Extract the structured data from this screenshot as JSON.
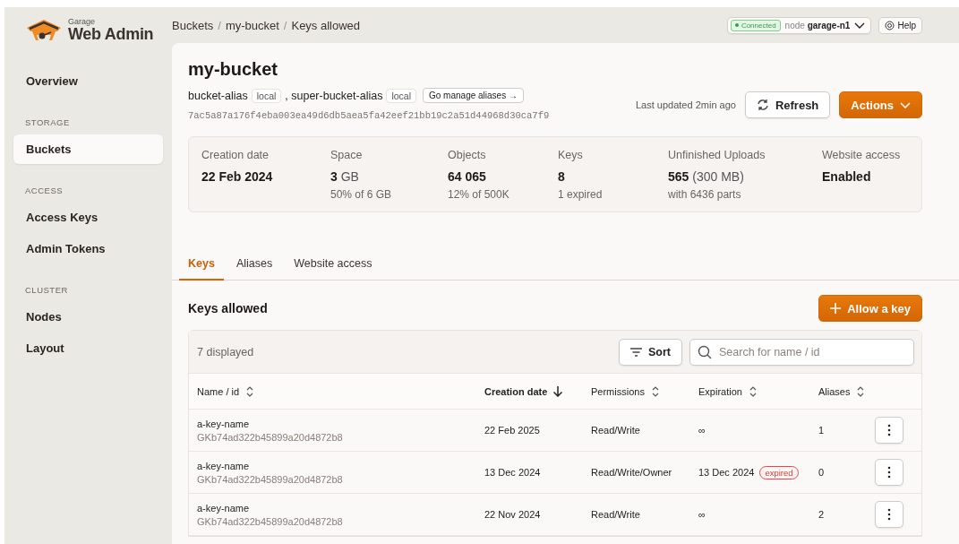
{
  "brand": {
    "small": "Garage",
    "name": "Web Admin"
  },
  "breadcrumb": [
    {
      "kind": "link",
      "label": "Buckets"
    },
    {
      "kind": "separator",
      "label": "/"
    },
    {
      "kind": "link",
      "label": "my-bucket"
    },
    {
      "kind": "separator",
      "label": "/"
    },
    {
      "kind": "current",
      "label": "Keys allowed"
    }
  ],
  "connection": {
    "status": "Connected",
    "connected": true,
    "node_label": "node",
    "node": "garage-n1"
  },
  "help_button": "Help",
  "sidebar": {
    "items": [
      {
        "kind": "item",
        "label": "Overview",
        "selected": false
      },
      {
        "kind": "section",
        "label": "STORAGE"
      },
      {
        "kind": "item",
        "label": "Buckets",
        "selected": true
      },
      {
        "kind": "section",
        "label": "ACCESS"
      },
      {
        "kind": "item",
        "label": "Access Keys",
        "selected": false
      },
      {
        "kind": "item",
        "label": "Admin Tokens",
        "selected": false
      },
      {
        "kind": "section",
        "label": "CLUSTER"
      },
      {
        "kind": "item",
        "label": "Nodes",
        "selected": false
      },
      {
        "kind": "item",
        "label": "Layout",
        "selected": false
      }
    ]
  },
  "bucket": {
    "title": "my-bucket",
    "aliases": [
      {
        "name": "bucket-alias",
        "tag": "local"
      },
      {
        "name": ", super-bucket-alias",
        "tag": "local"
      }
    ],
    "manage_aliases_button": "Go manage aliases →",
    "id": "7ac5a87a176f4eba003ea49d6db5aea5fa42eef21bb19c2a51d44968d30ca7f9",
    "last_updated": "Last updated 2min ago",
    "refresh_button": "Refresh",
    "actions_button": "Actions"
  },
  "stats": [
    {
      "label": "Creation date",
      "value": "22 Feb 2024"
    },
    {
      "label": "Space",
      "value": "3",
      "value_suffix": "GB",
      "detail": "50% of 6 GB"
    },
    {
      "label": "Objects",
      "value": "64 065",
      "detail": "12% of 500K"
    },
    {
      "label": "Keys",
      "value": "8",
      "detail": "1 expired"
    },
    {
      "label": "Unfinished Uploads",
      "value": "565",
      "value_suffix": "(300 MB)",
      "detail": "with 6436 parts"
    },
    {
      "label": "Website access",
      "value": "Enabled"
    }
  ],
  "tabs": [
    {
      "label": "Keys",
      "selected": true
    },
    {
      "label": "Aliases",
      "selected": false
    },
    {
      "label": "Website access",
      "selected": false
    }
  ],
  "keys_section": {
    "title": "Keys allowed",
    "add_button": "Allow a key",
    "count": "7 displayed",
    "sort_button": "Sort",
    "search": {
      "placeholder": "Search for name / id"
    }
  },
  "table": {
    "columns": [
      {
        "label": "Name / id",
        "sorted": false
      },
      {
        "label": "Creation date",
        "sorted": true
      },
      {
        "label": "Permissions",
        "sorted": false
      },
      {
        "label": "Expiration",
        "sorted": false
      },
      {
        "label": "Aliases",
        "sorted": false
      }
    ],
    "rows": [
      {
        "name": "a-key-name",
        "id": "GKb74ad322b45899a20d4872b8",
        "created": "22 Feb 2025",
        "permissions": "Read/Write",
        "expiration": "∞",
        "aliases": "1"
      },
      {
        "name": "a-key-name",
        "id": "GKb74ad322b45899a20d4872b8",
        "created": "13 Dec 2024",
        "permissions": "Read/Write/Owner",
        "expiration": "13 Dec 2024",
        "badge": "expired",
        "aliases": "0"
      },
      {
        "name": "a-key-name",
        "id": "GKb74ad322b45899a20d4872b8",
        "created": "22 Nov 2024",
        "permissions": "Read/Write",
        "expiration": "∞",
        "aliases": "2"
      }
    ]
  }
}
